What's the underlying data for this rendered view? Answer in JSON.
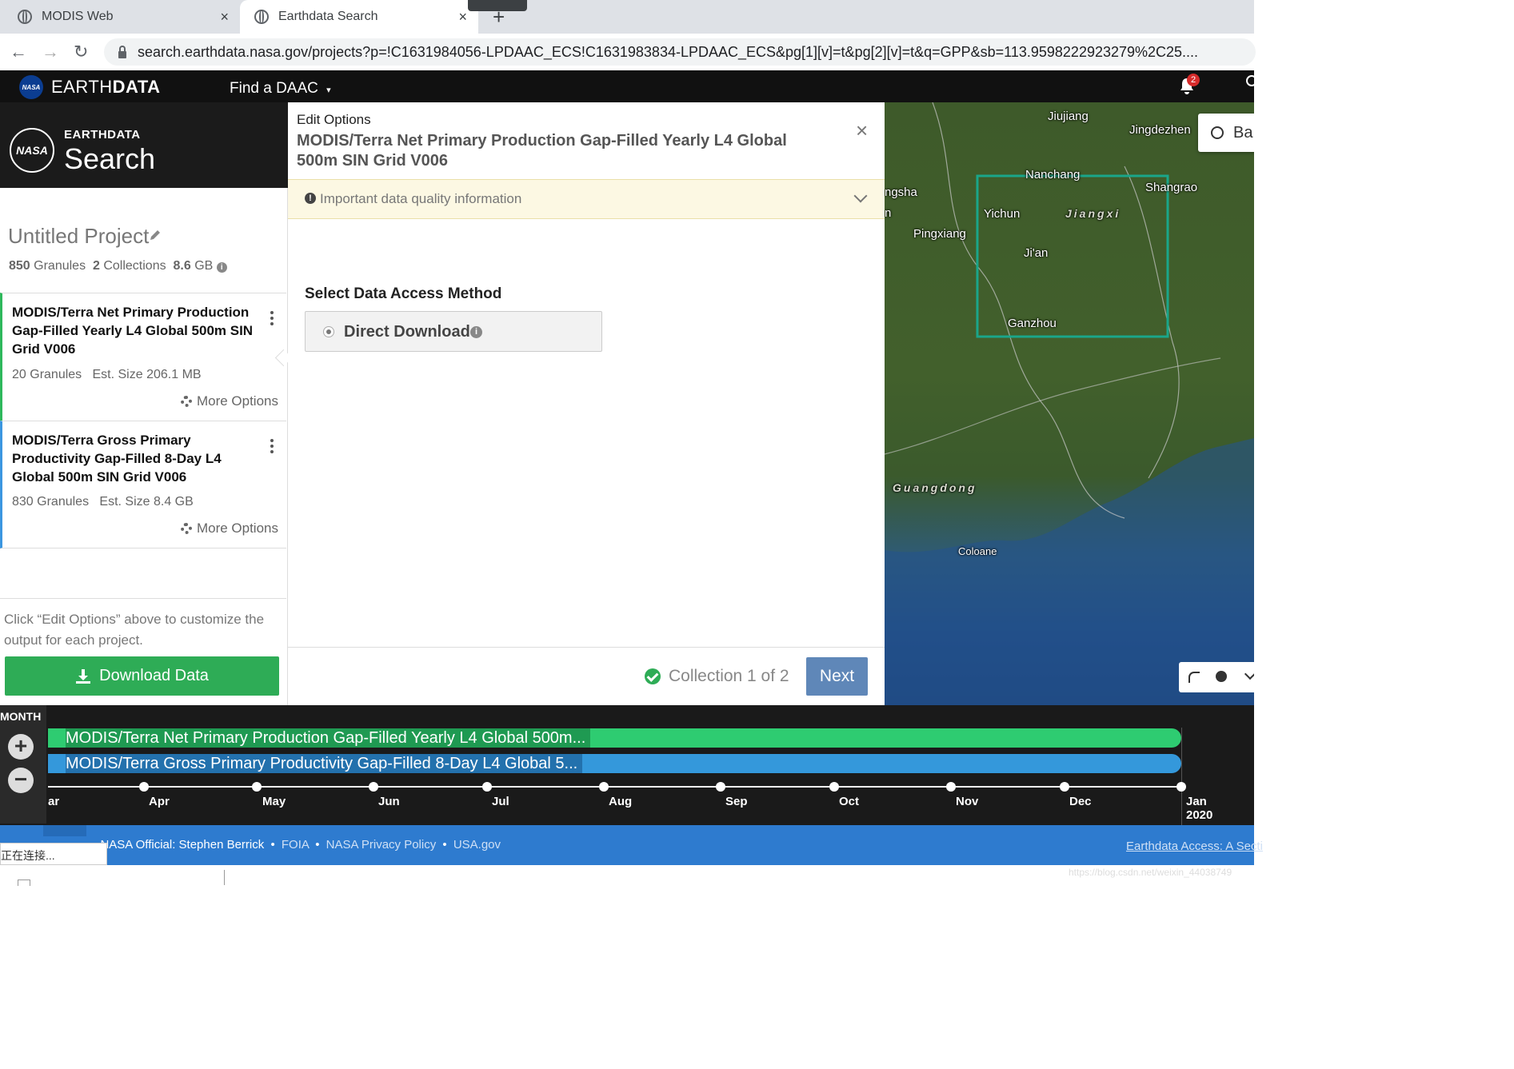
{
  "browser": {
    "tabs": [
      {
        "title": "MODIS Web",
        "close": "×"
      },
      {
        "title": "Earthdata Search",
        "close": "×"
      }
    ],
    "new_tab": "+",
    "url": "search.earthdata.nasa.gov/projects?p=!C1631984056-LPDAAC_ECS!C1631983834-LPDAAC_ECS&pg[1][v]=t&pg[2][v]=t&q=GPP&sb=113.9598222923279%2C25....",
    "nav": {
      "back": "←",
      "forward": "→",
      "reload": "↻"
    }
  },
  "header": {
    "logo_text": "NASA",
    "brand_light": "EARTH",
    "brand_bold": "DATA",
    "find_daac": "Find a DAAC",
    "caret": "▾",
    "notification_count": "2"
  },
  "sidebar": {
    "brand_small": "EARTHDATA",
    "brand_large": "Search",
    "project_title": "Untitled Project",
    "summary": {
      "granules_num": "850",
      "granules_label": "Granules",
      "collections_num": "2",
      "collections_label": "Collections",
      "size_num": "8.6",
      "size_unit": "GB"
    },
    "collections": [
      {
        "title": "MODIS/Terra Net Primary Production Gap-Filled Yearly L4 Global 500m SIN Grid V006",
        "meta": "20 Granules   Est. Size 206.1 MB",
        "more": "More Options",
        "accent": "#2eb85c"
      },
      {
        "title": "MODIS/Terra Gross Primary Productivity Gap-Filled 8-Day L4 Global 500m SIN Grid V006",
        "meta": "830 Granules   Est. Size 8.4 GB",
        "more": "More Options",
        "accent": "#3b96e0"
      }
    ],
    "hint": "Click “Edit Options” above to customize the output for each project.",
    "download_label": "Download Data"
  },
  "panel": {
    "heading": "Edit Options",
    "title": "MODIS/Terra Net Primary Production Gap-Filled Yearly L4 Global 500m SIN Grid V006",
    "close": "×",
    "quality_notice": "Important data quality information",
    "section_label": "Select Data Access Method",
    "method_label": "Direct Download",
    "collection_status": "Collection 1 of 2",
    "next_label": "Next"
  },
  "map": {
    "labels": [
      "Jiujiang",
      "Jingdezhen",
      "Nanchang",
      "ngsha",
      "Shangrao",
      "Yichun",
      "Jiangxi",
      "Pingxiang",
      "Ji'an",
      "Ganzhou",
      "Guangdong",
      "Coloane",
      "n"
    ],
    "back_button": "Ba"
  },
  "timeline": {
    "zoom_label": "MONTH",
    "zoom_in": "+",
    "zoom_out": "−",
    "bars": [
      {
        "label": "MODIS/Terra Net Primary Production Gap-Filled Yearly L4 Global 500m...",
        "color": "#2ecc71"
      },
      {
        "label": "MODIS/Terra Gross Primary Productivity Gap-Filled 8-Day L4 Global 5...",
        "color": "#3498db"
      }
    ],
    "months": [
      "ar",
      "Apr",
      "May",
      "Jun",
      "Jul",
      "Aug",
      "Sep",
      "Oct",
      "Nov",
      "Dec",
      "Jan"
    ],
    "year": "2020"
  },
  "footer": {
    "official": "NASA Official: Stephen Berrick",
    "links": [
      "FOIA",
      "NASA Privacy Policy",
      "USA.gov"
    ],
    "right_link": "Earthdata Access: A Secti"
  },
  "status": {
    "connecting": "正在连接...",
    "watermark": "https://blog.csdn.net/weixin_44038749"
  }
}
